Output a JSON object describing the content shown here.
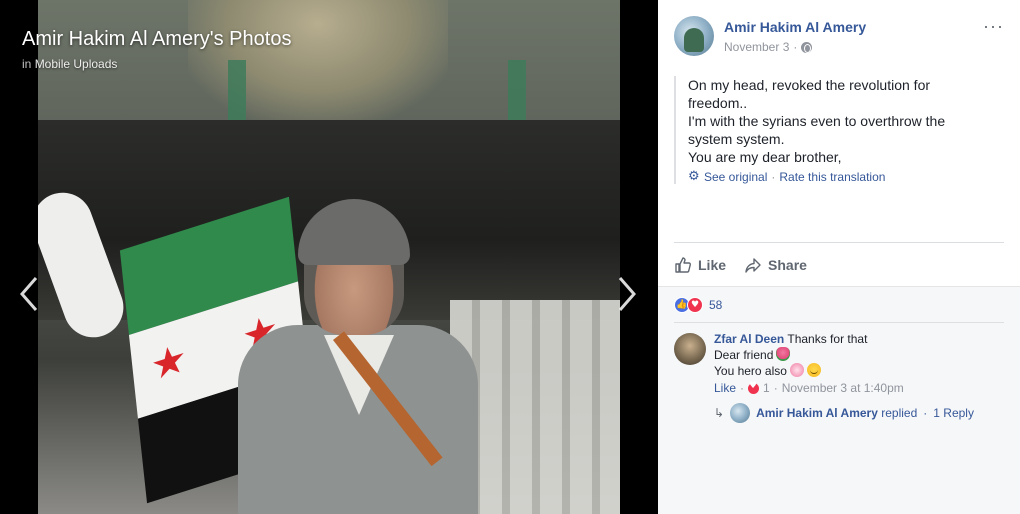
{
  "viewer": {
    "title": "Amir Hakim Al Amery's Photos",
    "subtitle_prefix": "in",
    "subtitle_album": "Mobile Uploads"
  },
  "post": {
    "author": "Amir Hakim Al Amery",
    "date": "November 3",
    "dot": "·",
    "more": "···",
    "translation_lines": [
      "On my head, revoked the revolution for",
      "freedom..",
      "I'm with the syrians even to overthrow the",
      "system system.",
      "You are my dear brother,"
    ],
    "see_original": "See original",
    "trans_sep": "·",
    "rate_translation": "Rate this translation"
  },
  "actions": {
    "like": "Like",
    "share": "Share"
  },
  "reactions": {
    "count": "58"
  },
  "comments": [
    {
      "author": "Zfar Al Deen",
      "line1": "Thanks for that",
      "line2": "Dear friend",
      "line3": "You hero also",
      "like": "Like",
      "sep": "·",
      "love_count": "1",
      "time": "November 3 at 1:40pm"
    }
  ],
  "reply": {
    "author": "Amir Hakim Al Amery",
    "verb": "replied",
    "sep": "·",
    "count": "1 Reply"
  },
  "colors": {
    "link": "#365899",
    "muted": "#90949c",
    "panel_bg": "#ffffff",
    "comments_bg": "#f6f7f9",
    "like_blue": "#4a6fe3",
    "love_red": "#f0334f"
  },
  "icons": [
    "chevron-left-icon",
    "chevron-right-icon",
    "globe-icon",
    "more-icon",
    "gear-icon",
    "like-icon",
    "share-icon",
    "like-reaction-icon",
    "love-reaction-icon",
    "reply-arrow-icon",
    "tulip-emoji",
    "blossom-emoji",
    "smile-emoji"
  ]
}
